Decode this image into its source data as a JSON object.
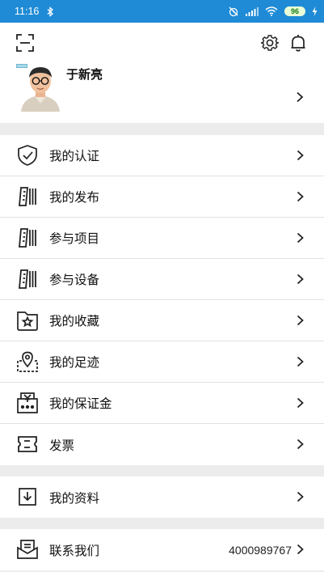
{
  "status_bar": {
    "time": "11:16",
    "battery": "96",
    "background": "#1f8bd6"
  },
  "profile": {
    "username": "于新亮"
  },
  "menu_group_1": [
    {
      "label": "我的认证",
      "icon": "shield-check-icon"
    },
    {
      "label": "我的发布",
      "icon": "document-stack-icon"
    },
    {
      "label": "参与项目",
      "icon": "document-stack-icon"
    },
    {
      "label": "参与设备",
      "icon": "document-stack-icon"
    },
    {
      "label": "我的收藏",
      "icon": "folder-star-icon"
    },
    {
      "label": "我的足迹",
      "icon": "map-pin-icon"
    },
    {
      "label": "我的保证金",
      "icon": "deposit-yen-icon"
    },
    {
      "label": "发票",
      "icon": "ticket-icon"
    }
  ],
  "menu_group_2": [
    {
      "label": "我的资料",
      "icon": "download-box-icon"
    }
  ],
  "menu_group_3": [
    {
      "label": "联系我们",
      "icon": "envelope-tray-icon",
      "value": "4000989767"
    }
  ]
}
